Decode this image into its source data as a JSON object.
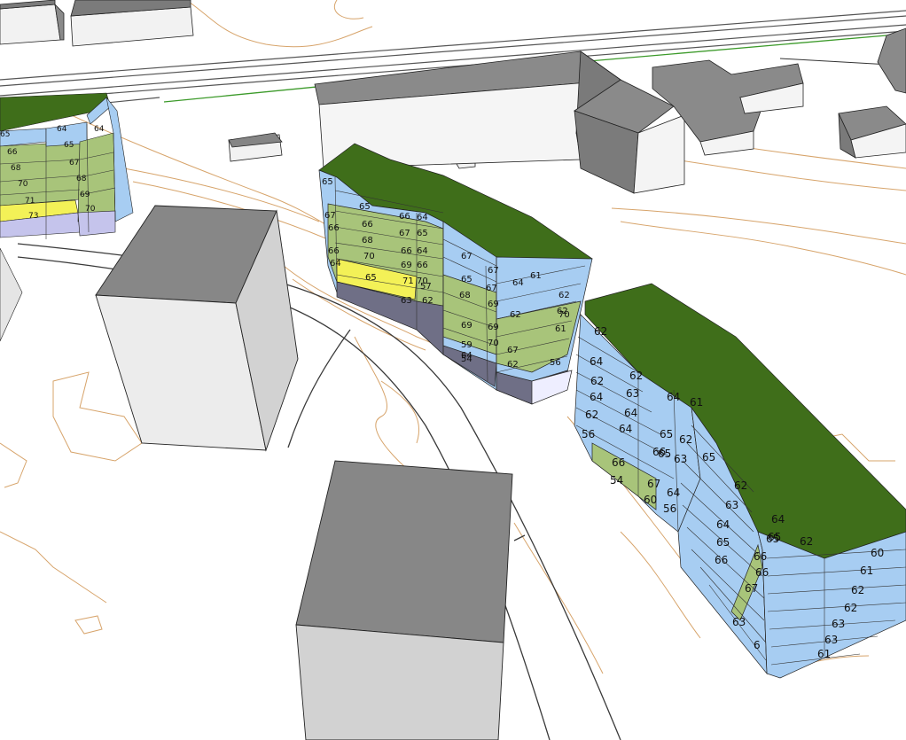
{
  "scene": {
    "title": "",
    "colors": {
      "background": "#ffffff",
      "roof_green": "#3f6e1a",
      "facade_blue": "#a7cdf2",
      "facade_green": "#a8c47a",
      "facade_yellow": "#f3f157",
      "facade_lilac": "#c5c4ec",
      "facade_dark": "#6f6f86",
      "block_top": "#878787",
      "block_side": "#d2d2d2",
      "block_front": "#ececec",
      "contour": "#d7a46b",
      "road_line": "#3a3a3a",
      "green_line": "#3c9a2a"
    },
    "legend_note": "",
    "building_left": {
      "labels": [
        "65",
        "64",
        "65",
        "66",
        "64",
        "68",
        "67",
        "70",
        "68",
        "69",
        "71",
        "70",
        "73"
      ]
    },
    "building_center": {
      "labels": [
        "65",
        "65",
        "66",
        "64",
        "67",
        "66",
        "67",
        "65",
        "66",
        "68",
        "66",
        "64",
        "66",
        "70",
        "69",
        "66",
        "64",
        "65",
        "71",
        "70",
        "67",
        "67",
        "57",
        "63",
        "62",
        "68",
        "67",
        "59",
        "62",
        "65",
        "69",
        "61",
        "69",
        "62",
        "70",
        "67",
        "69",
        "54",
        "70",
        "64",
        "64",
        "61",
        "62",
        "62",
        "56"
      ]
    },
    "building_right": {
      "labels": [
        "62",
        "62",
        "64",
        "62",
        "64",
        "64",
        "61",
        "63",
        "64",
        "65",
        "62",
        "64",
        "65",
        "63",
        "62",
        "56",
        "66",
        "64",
        "66",
        "60",
        "67",
        "54",
        "65",
        "56",
        "62",
        "63",
        "64",
        "65",
        "66",
        "66",
        "62",
        "65",
        "66",
        "67",
        "63",
        "60",
        "61",
        "62",
        "62",
        "63",
        "63",
        "61",
        "64",
        "65",
        "6"
      ]
    }
  }
}
